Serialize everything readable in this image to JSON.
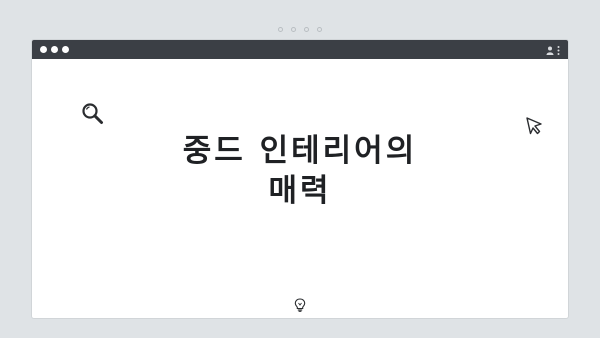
{
  "page": {
    "background_color": "#dfe3e6",
    "carousel_dots_count": 4
  },
  "window": {
    "titlebar_color": "#3b3f45",
    "content_background": "#ffffff",
    "traffic_lights": [
      "dot",
      "dot",
      "dot"
    ],
    "controls": [
      "user-icon",
      "more-vertical-icon"
    ]
  },
  "content": {
    "headline_lines": [
      "중드 인테리어의",
      "매력"
    ],
    "icons": {
      "top_left": "search-icon",
      "top_right": "cursor-arrow-icon",
      "bottom_center": "lightbulb-icon"
    }
  }
}
